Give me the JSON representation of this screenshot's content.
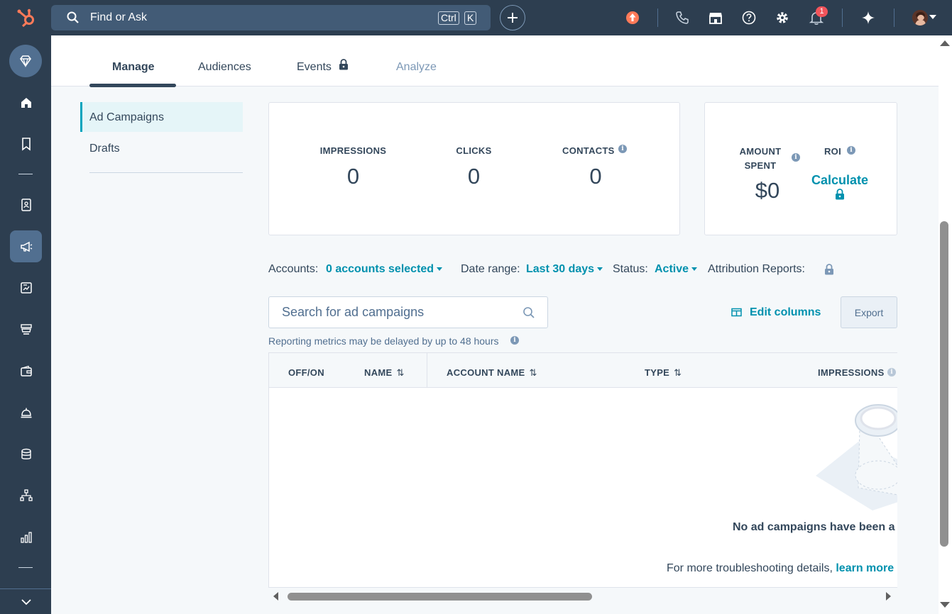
{
  "topbar": {
    "search_placeholder": "Find or Ask",
    "kbd_ctrl": "Ctrl",
    "kbd_k": "K",
    "notification_count": "1"
  },
  "tabs": [
    {
      "label": "Manage"
    },
    {
      "label": "Audiences"
    },
    {
      "label": "Events"
    },
    {
      "label": "Analyze"
    }
  ],
  "sidebar": {
    "items": [
      {
        "label": "Ad Campaigns"
      },
      {
        "label": "Drafts"
      }
    ]
  },
  "metrics": {
    "impressions_label": "IMPRESSIONS",
    "impressions_value": "0",
    "clicks_label": "CLICKS",
    "clicks_value": "0",
    "contacts_label": "CONTACTS",
    "contacts_value": "0",
    "amount_spent_label_1": "AMOUNT",
    "amount_spent_label_2": "SPENT",
    "amount_spent_value": "$0",
    "roi_label": "ROI",
    "roi_link": "Calculate"
  },
  "filters": {
    "accounts_label": "Accounts:",
    "accounts_value": "0 accounts selected",
    "date_label": "Date range:",
    "date_value": "Last 30 days",
    "status_label": "Status:",
    "status_value": "Active",
    "attribution_label": "Attribution Reports:"
  },
  "search": {
    "placeholder": "Search for ad campaigns"
  },
  "actions": {
    "edit_columns": "Edit columns",
    "export": "Export"
  },
  "note": "Reporting metrics may be delayed by up to 48 hours",
  "table": {
    "columns": [
      "OFF/ON",
      "NAME",
      "ACCOUNT NAME",
      "TYPE",
      "IMPRESSIONS"
    ],
    "empty_title": "No ad campaigns have been a",
    "empty_sub_text": "For more troubleshooting details, ",
    "empty_sub_link": "learn more"
  },
  "colors": {
    "accent": "#0091ae",
    "nav_bg": "#2d3e50",
    "text": "#33475b"
  }
}
